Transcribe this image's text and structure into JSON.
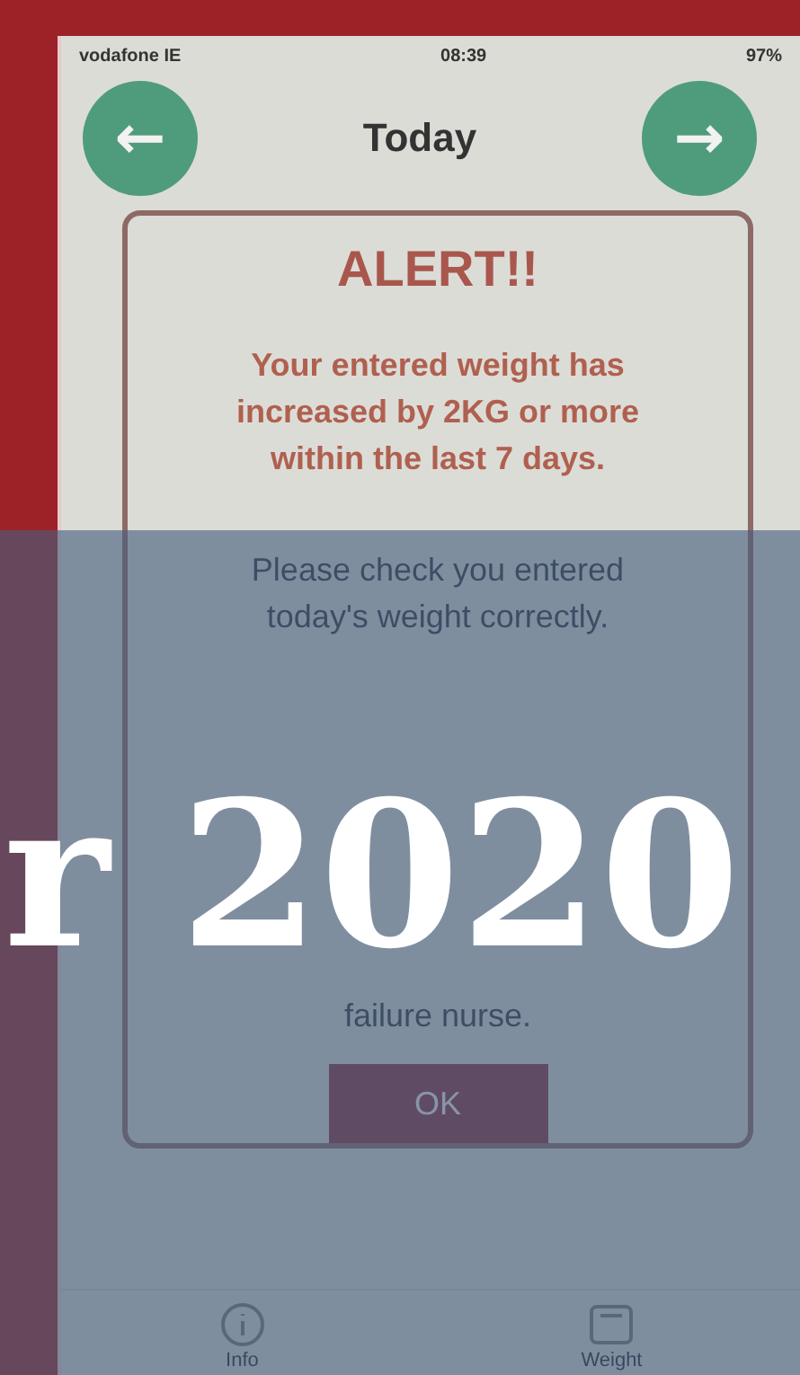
{
  "status_bar": {
    "carrier": "vodafone IE",
    "time": "08:39",
    "battery": "97%"
  },
  "header": {
    "title": "Today",
    "back_label": "←",
    "forward_label": "→"
  },
  "alert": {
    "title": "ALERT!!",
    "paragraphs": [
      "Your entered weight has increased by 2KG or more within the last 7 days.",
      "Please check you entered today's weight correctly.",
      "failure nurse."
    ],
    "button": "OK"
  },
  "tab_bar": [
    {
      "label": "Info",
      "kind": "info"
    },
    {
      "label": "Weight",
      "kind": "weight"
    }
  ],
  "banner": {
    "text": "r 2020"
  }
}
